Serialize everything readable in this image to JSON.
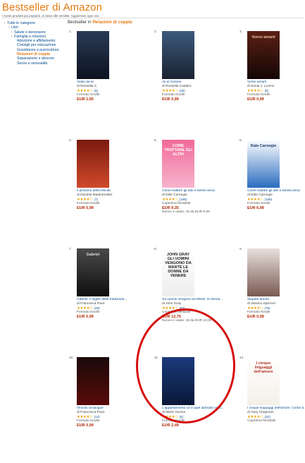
{
  "header": {
    "title": "Bestseller di Amazon",
    "subtitle": "I nostri prodotti più popolari, in base alle vendite. Aggiornato ogni ora."
  },
  "sidebar": {
    "items": [
      {
        "label": "Tutte le categorie",
        "level": 0
      },
      {
        "label": "Libri",
        "level": 1
      },
      {
        "label": "Salute e benessere",
        "level": 2
      },
      {
        "label": "Famiglia e relazioni",
        "level": 2
      },
      {
        "label": "Adozione e affidamento",
        "level": 3
      },
      {
        "label": "Consigli per educazione",
        "level": 3
      },
      {
        "label": "Gravidanza e puericultura",
        "level": 3
      },
      {
        "label": "Relazioni di coppia",
        "level": 3,
        "selected": true
      },
      {
        "label": "Separazione e divorzio",
        "level": 3
      },
      {
        "label": "Sesso e sessualità",
        "level": 3
      }
    ]
  },
  "main": {
    "title_prefix": "Bestseller in",
    "title_category": "Relazioni di coppia"
  },
  "books": [
    {
      "rank": "1.",
      "title": "Voleri da te",
      "author": "di Rossella C.",
      "stars": "★★★★☆",
      "reviews": "(6)",
      "format": "Formato Kindle",
      "price": "EUR 1,50",
      "extra": "",
      "cover_top": "#2a3a55",
      "cover_bottom": "#0c1220",
      "cover_text": "",
      "text_color": "#cfd8e8"
    },
    {
      "rank": "2.",
      "title": "Ali di Cenere",
      "author": "di Rossella Calabrò",
      "stars": "★★★★☆",
      "reviews": "(26)",
      "format": "Formato Kindle",
      "price": "EUR 0,99",
      "extra": "",
      "cover_top": "#3c5a7c",
      "cover_bottom": "#1a2230",
      "cover_text": "",
      "text_color": "#fff"
    },
    {
      "rank": "3.",
      "title": "Vorrei amarti",
      "author": "di Sonia J. Lorenz",
      "stars": "★★★★☆",
      "reviews": "(8)",
      "format": "Formato Kindle",
      "price": "EUR 0,99",
      "extra": "",
      "cover_top": "#5a2014",
      "cover_bottom": "#140605",
      "cover_text": "Vorrei amarti",
      "text_color": "#f0c0a0"
    },
    {
      "rank": "4.",
      "title": "Il profumo della felicità",
      "author": "di Daniela Mastromattei",
      "stars": "★★★★☆",
      "reviews": "(7)",
      "format": "Formato Kindle",
      "price": "EUR 0,99",
      "extra": "",
      "cover_top": "#7a1a10",
      "cover_bottom": "#d04a2a",
      "cover_text": "",
      "text_color": "#fff"
    },
    {
      "rank": "5.",
      "title": "Come trattare gli altri e farseli amici",
      "author": "di Dale Carnegie",
      "stars": "★★★★☆",
      "reviews": "(109)",
      "format": "Copertina flessibile",
      "price": "EUR 9,35",
      "extra": "Nuovo e usato: 15 da EUR 9,35",
      "cover_top": "#f26a9a",
      "cover_bottom": "#f7b4cc",
      "cover_text": "COME TRATTARE GLI ALTRI",
      "text_color": "#ffffff"
    },
    {
      "rank": "6.",
      "title": "Come trattare gli altri e farseli amici",
      "author": "di Dale Carnegie",
      "stars": "★★★★☆",
      "reviews": "(109)",
      "format": "Formato Kindle",
      "price": "EUR 6,99",
      "extra": "",
      "cover_top": "#ffffff",
      "cover_bottom": "#2a6cc0",
      "cover_text": "Dale Carnegie",
      "text_color": "#1a3a6a"
    },
    {
      "rank": "7.",
      "title": "Gabriel. Il sigillo della tradizione...",
      "author": "di Francesca Pace",
      "stars": "★★★★☆",
      "reviews": "(26)",
      "format": "Formato Kindle",
      "price": "EUR 0,99",
      "extra": "",
      "cover_top": "#4a4a4a",
      "cover_bottom": "#0e0e0e",
      "cover_text": "Gabriel",
      "text_color": "#ddd"
    },
    {
      "rank": "8.",
      "title": "Gli uomini vengono da Marte, le donne...",
      "author": "di John Gray",
      "stars": "★★★★☆",
      "reviews": "(63)",
      "format": "Copertina flessibile",
      "price": "EUR 12,75",
      "extra": "Nuovo e usato: 18 da EUR 10,00",
      "cover_top": "#ffffff",
      "cover_bottom": "#eeeeee",
      "cover_text": "JOHN GRAY GLI UOMINI VENGONO DA MARTE LE DONNE DA VENERE",
      "text_color": "#222"
    },
    {
      "rank": "9.",
      "title": "Stupido amore",
      "author": "di Jessica Spencer",
      "stars": "★★★★☆",
      "reviews": "(76)",
      "format": "Formato Kindle",
      "price": "EUR 0,99",
      "extra": "",
      "cover_top": "#e8e0dc",
      "cover_bottom": "#7a5a52",
      "cover_text": "",
      "text_color": "#333"
    },
    {
      "rank": "10.",
      "title": "Vincolo di sangue",
      "author": "di Francesca Pace",
      "stars": "★★★★☆",
      "reviews": "(13)",
      "format": "Formato Kindle",
      "price": "EUR 0,99",
      "extra": "",
      "cover_top": "#1a0a0a",
      "cover_bottom": "#5a0a0a",
      "cover_text": "",
      "text_color": "#ddd"
    },
    {
      "rank": "11.",
      "title": "L'appartamento 14 e quel dannato vicio...",
      "author": "di Marie Sexton",
      "stars": "★★★★☆",
      "reviews": "(5)",
      "format": "Formato Kindle",
      "price": "EUR 2,49",
      "extra": "",
      "cover_top": "#1a3a7a",
      "cover_bottom": "#0a1838",
      "cover_text": "",
      "text_color": "#dde"
    },
    {
      "rank": "12.",
      "title": "I cinque linguaggi dell'amore. Come d...",
      "author": "di Gary Chapman",
      "stars": "★★★★☆",
      "reviews": "(22)",
      "format": "Copertina flessibile",
      "price": "",
      "extra": "",
      "cover_top": "#ffffff",
      "cover_bottom": "#f4f0e8",
      "cover_text": "I cinque linguaggi dell'amore",
      "text_color": "#b03020"
    }
  ]
}
